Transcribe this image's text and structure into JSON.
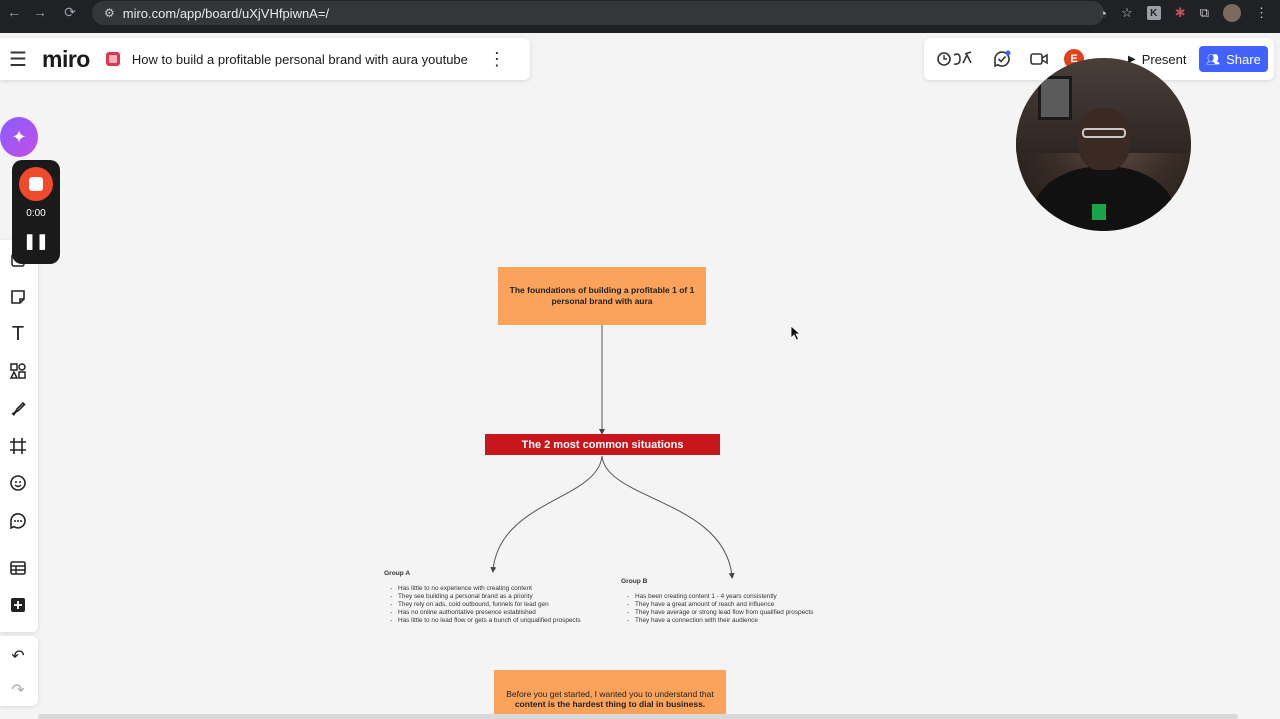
{
  "browser": {
    "url": "miro.com/app/board/uXjVHfpiwnA=/",
    "nav_back": "←",
    "nav_forward": "→",
    "nav_reload": "⟳",
    "ext_k": "K",
    "menu": "⋮"
  },
  "header": {
    "menu_icon": "☰",
    "logo": "miro",
    "board_title": "How to build a profitable personal brand with aura youtube",
    "more_icon": "⋮"
  },
  "right_bar": {
    "avatar_initial": "E",
    "present_label": "Present",
    "share_label": "Share"
  },
  "recorder": {
    "time": "0:00"
  },
  "board": {
    "foundations_text": "The foundations of building a profitable 1 of 1 personal brand with aura",
    "situations_text": "The 2 most common situations",
    "group_a": {
      "title": "Group A",
      "items": [
        "Has little to no experience with creating content",
        "They see building a personal brand as a priority",
        "They rely on ads, cold outbound, funnels for lead gen",
        "Has no online authoritative presence established",
        "Has little to no lead flow or gets a bunch of unqualified prospects"
      ]
    },
    "group_b": {
      "title": "Group B",
      "items": [
        "Has been creating content 1 - 4 years consistently",
        "They have a great amount of reach and influence",
        "They have average or strong lead flow from qualified prospects",
        "They have a connection with their audience"
      ]
    },
    "bottom_line1": "Before you get started, I wanted you to understand that",
    "bottom_line2": "content is the hardest thing to dial in business."
  }
}
